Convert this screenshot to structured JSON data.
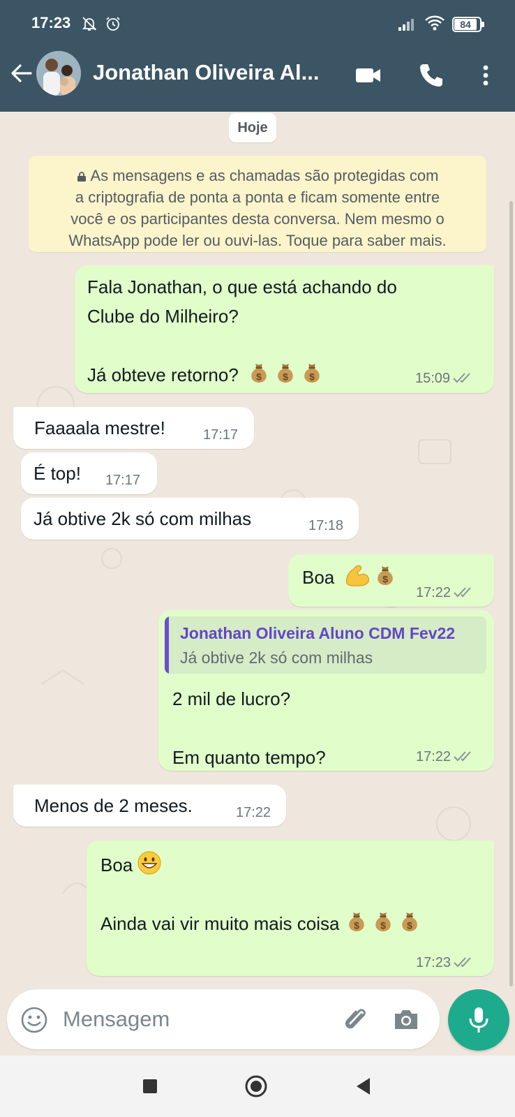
{
  "status_bar": {
    "time": "17:23",
    "battery": "84",
    "icons": [
      "bell-muted-icon",
      "alarm-icon",
      "signal-icon",
      "wifi-icon",
      "battery-icon"
    ]
  },
  "header": {
    "contact_name": "Jonathan Oliveira Al...",
    "icons": [
      "back-arrow-icon",
      "video-call-icon",
      "phone-call-icon",
      "more-options-icon"
    ],
    "color": "#3b5564"
  },
  "chat": {
    "date_label": "Hoje",
    "encryption_notice": {
      "line1": "As mensagens e as chamadas são protegidas com",
      "line2": "a criptografia de ponta a ponta e ficam somente entre",
      "line3": "você e os participantes desta conversa. Nem mesmo o",
      "line4": "WhatsApp pode ler ou ouvi-las. Toque para saber mais."
    },
    "messages": [
      {
        "dir": "out",
        "lines": [
          "Fala Jonathan, o que está achando do",
          "Clube do Milheiro?",
          "",
          "Já obteve retorno?"
        ],
        "emoji": [
          "money-bag-icon",
          "money-bag-icon",
          "money-bag-icon"
        ],
        "time": "15:09",
        "status": "read"
      },
      {
        "dir": "in",
        "text": "Faaaala mestre!",
        "time": "17:17"
      },
      {
        "dir": "in",
        "text": "É top!",
        "time": "17:17"
      },
      {
        "dir": "in",
        "text": "Já obtive 2k só com milhas",
        "time": "17:18"
      },
      {
        "dir": "out",
        "text": "Boa",
        "emoji": [
          "flexed-biceps-icon",
          "money-bag-icon"
        ],
        "time": "17:22",
        "status": "read"
      },
      {
        "dir": "out",
        "quote": {
          "author": "Jonathan Oliveira Aluno CDM Fev22",
          "text": "Já obtive 2k só com milhas"
        },
        "lines": [
          "2 mil de lucro?",
          "",
          "Em quanto tempo?"
        ],
        "time": "17:22",
        "status": "read"
      },
      {
        "dir": "in",
        "text": "Menos de 2 meses.",
        "time": "17:22"
      },
      {
        "dir": "out",
        "lines": [
          "Boa",
          "",
          "Ainda vai vir muito mais coisa"
        ],
        "emoji": [
          "grinning-face-icon",
          "money-bag-icon",
          "money-bag-icon",
          "money-bag-icon"
        ],
        "time": "17:23",
        "status": "read"
      }
    ]
  },
  "composer": {
    "placeholder": "Mensagem",
    "icons": [
      "emoji-icon",
      "attach-icon",
      "camera-icon",
      "mic-icon"
    ],
    "accent": "#1eaa8d"
  },
  "nav_bar": {
    "icons": [
      "recents-square-icon",
      "home-circle-icon",
      "back-triangle-icon"
    ]
  },
  "colors": {
    "outgoing_bubble": "#e1fdc9",
    "incoming_bubble": "#ffffff",
    "wallpaper": "#efe7de",
    "notice": "#fcf4cb"
  }
}
